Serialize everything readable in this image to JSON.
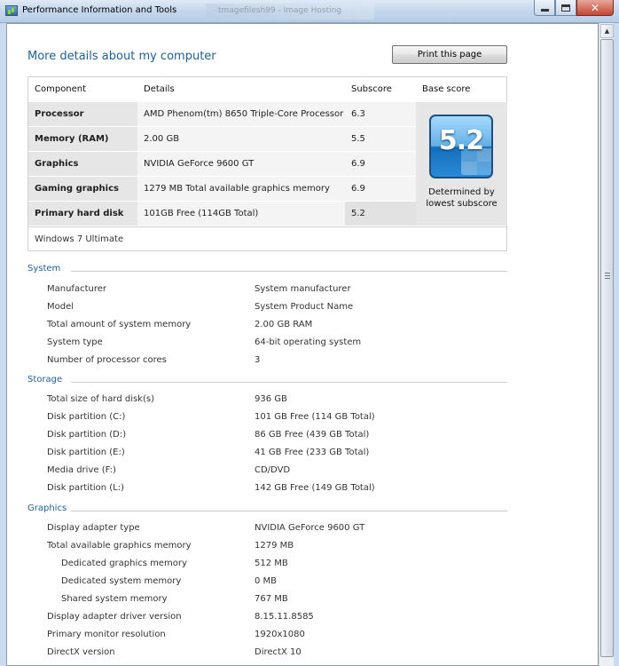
{
  "window": {
    "title": "Performance Information and Tools",
    "background_tab_label": "tmagefilesh99 - Image Hosting"
  },
  "header": {
    "page_title": "More details about my computer",
    "print_button": "Print this page"
  },
  "score_table": {
    "columns": {
      "component": "Component",
      "details": "Details",
      "subscore": "Subscore",
      "base_score": "Base score"
    },
    "rows": [
      {
        "component": "Processor",
        "details": "AMD Phenom(tm) 8650 Triple-Core Processor",
        "subscore": "6.3"
      },
      {
        "component": "Memory (RAM)",
        "details": "2.00 GB",
        "subscore": "5.5"
      },
      {
        "component": "Graphics",
        "details": "NVIDIA GeForce 9600 GT",
        "subscore": "6.9"
      },
      {
        "component": "Gaming graphics",
        "details": "1279 MB Total available graphics memory",
        "subscore": "6.9"
      },
      {
        "component": "Primary hard disk",
        "details": "101GB Free (114GB Total)",
        "subscore": "5.2"
      }
    ],
    "base_score": "5.2",
    "base_caption_line1": "Determined by",
    "base_caption_line2": "lowest subscore",
    "os_edition": "Windows 7 Ultimate"
  },
  "sections": {
    "system": {
      "title": "System",
      "items": [
        {
          "label": "Manufacturer",
          "value": "System manufacturer"
        },
        {
          "label": "Model",
          "value": "System Product Name"
        },
        {
          "label": "Total amount of system memory",
          "value": "2.00 GB RAM"
        },
        {
          "label": "System type",
          "value": "64-bit operating system"
        },
        {
          "label": "Number of processor cores",
          "value": "3"
        }
      ]
    },
    "storage": {
      "title": "Storage",
      "items": [
        {
          "label": "Total size of hard disk(s)",
          "value": "936 GB"
        },
        {
          "label": "Disk partition (C:)",
          "value": "101 GB Free (114 GB Total)"
        },
        {
          "label": "Disk partition (D:)",
          "value": "86 GB Free (439 GB Total)"
        },
        {
          "label": "Disk partition (E:)",
          "value": "41 GB Free (233 GB Total)"
        },
        {
          "label": "Media drive (F:)",
          "value": "CD/DVD"
        },
        {
          "label": "Disk partition (L:)",
          "value": "142 GB Free (149 GB Total)"
        }
      ]
    },
    "graphics": {
      "title": "Graphics",
      "items": [
        {
          "label": "Display adapter type",
          "value": "NVIDIA GeForce 9600 GT"
        },
        {
          "label": "Total available graphics memory",
          "value": "1279 MB"
        },
        {
          "label": "Dedicated graphics memory",
          "value": "512 MB"
        },
        {
          "label": "Dedicated system memory",
          "value": "0 MB"
        },
        {
          "label": "Shared system memory",
          "value": "767 MB"
        },
        {
          "label": "Display adapter driver version",
          "value": "8.15.11.8585"
        },
        {
          "label": "Primary monitor resolution",
          "value": "1920x1080"
        },
        {
          "label": "DirectX version",
          "value": "DirectX 10"
        }
      ]
    }
  },
  "colors": {
    "heading_blue": "#1e5fa0",
    "row_label_bg": "#e6e6e6",
    "row_detail_bg": "#f4f4f4"
  }
}
